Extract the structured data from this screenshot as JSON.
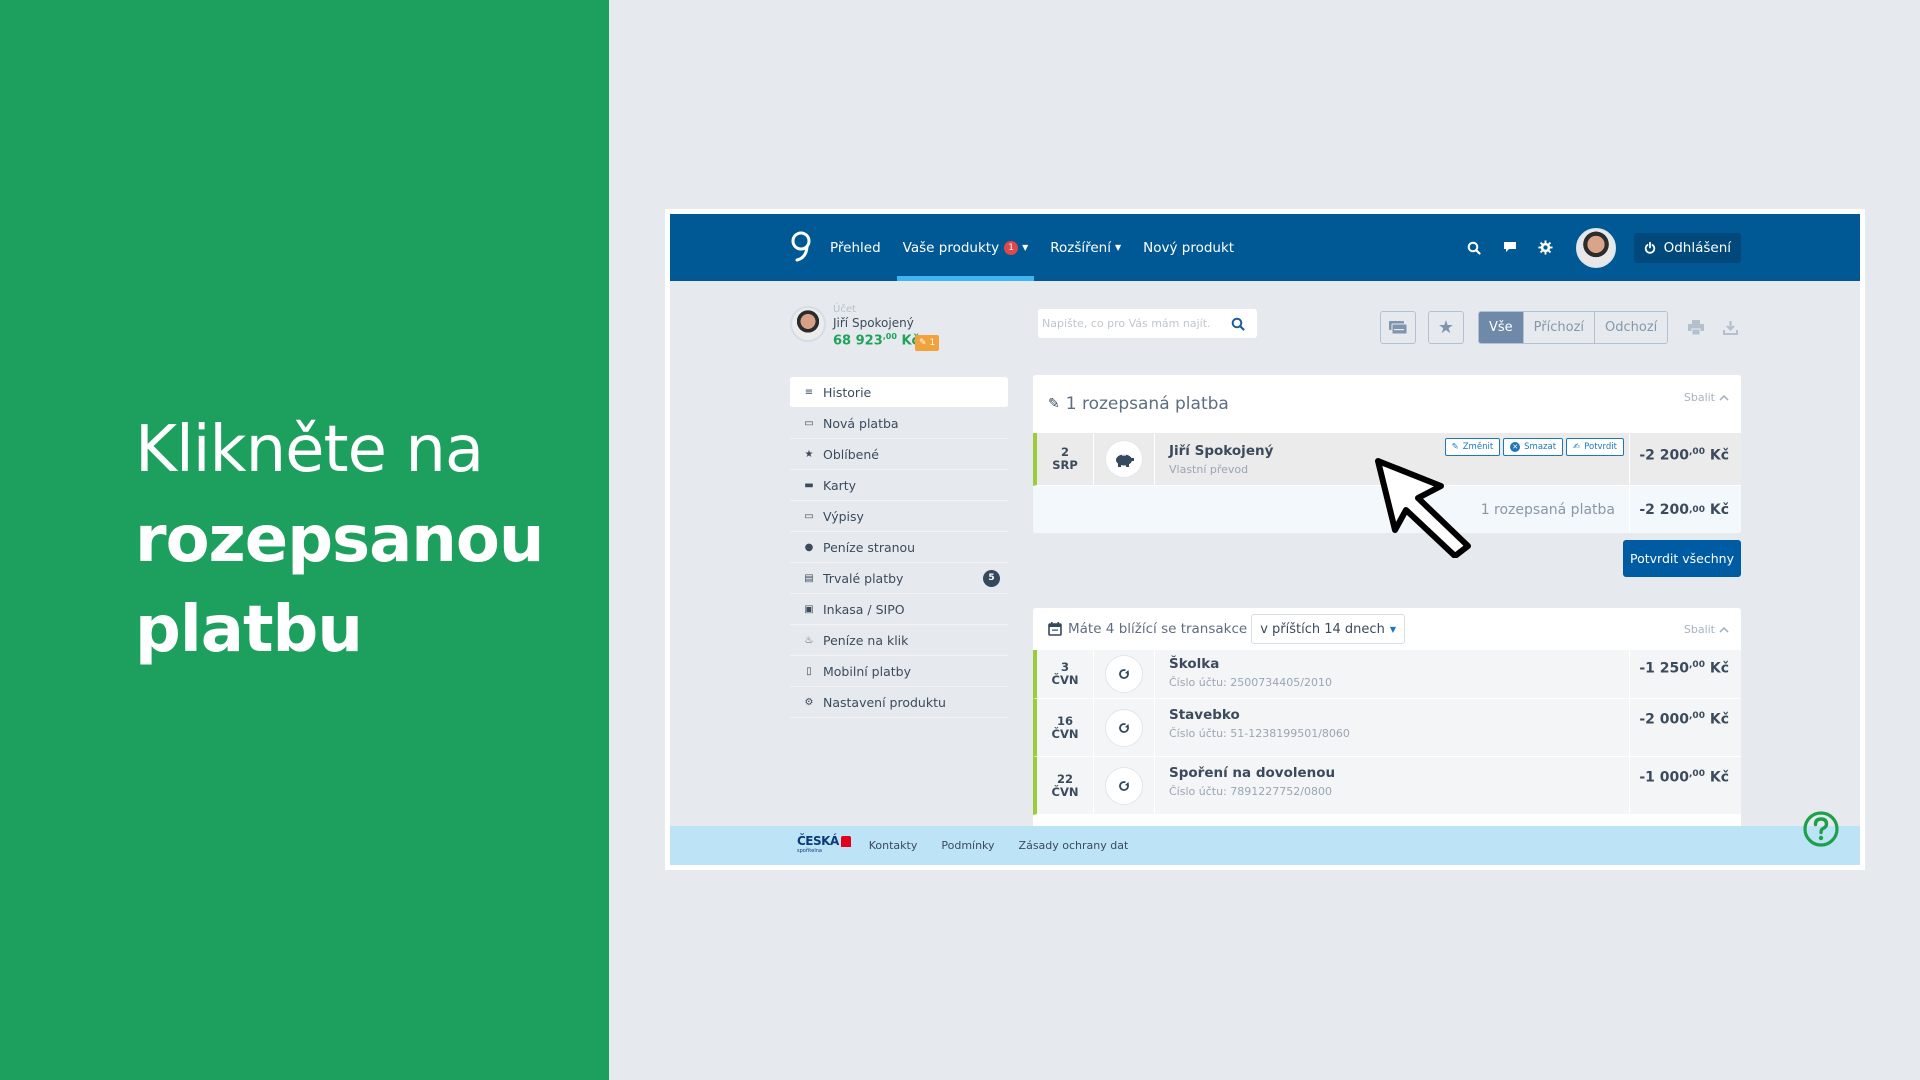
{
  "instruction": {
    "line1": "Klikněte na",
    "line2": "rozepsanou",
    "line3": "platbu"
  },
  "header": {
    "logo_icon": "george-logo-icon",
    "nav": [
      {
        "label": "Přehled",
        "active": false
      },
      {
        "label": "Vaše produkty",
        "active": true,
        "badge": "1",
        "dropdown": true
      },
      {
        "label": "Rozšíření",
        "active": false,
        "dropdown": true
      },
      {
        "label": "Nový produkt",
        "active": false
      }
    ],
    "icons": [
      "search-icon",
      "chat-icon",
      "gear-icon"
    ],
    "logout_label": "Odhlášení"
  },
  "profile": {
    "label": "Účet",
    "name": "Jiří Spokojený",
    "balance_main": "68 923",
    "balance_decimals": ",00",
    "currency": "Kč",
    "pending_count": "1"
  },
  "sidebar": {
    "items": [
      {
        "label": "Historie",
        "icon": "list-icon",
        "glyph": "≡",
        "active": true
      },
      {
        "label": "Nová platba",
        "icon": "payment-icon",
        "glyph": "▭"
      },
      {
        "label": "Oblíbené",
        "icon": "star-icon",
        "glyph": "★"
      },
      {
        "label": "Karty",
        "icon": "card-icon",
        "glyph": "▬"
      },
      {
        "label": "Výpisy",
        "icon": "statement-icon",
        "glyph": "▭"
      },
      {
        "label": "Peníze stranou",
        "icon": "piggy-bank-icon",
        "glyph": "●"
      },
      {
        "label": "Trvalé platby",
        "icon": "clipboard-icon",
        "glyph": "▤",
        "count": "5"
      },
      {
        "label": "Inkasa / SIPO",
        "icon": "clipboard-check-icon",
        "glyph": "▣"
      },
      {
        "label": "Peníze na klik",
        "icon": "click-money-icon",
        "glyph": "♨"
      },
      {
        "label": "Mobilní platby",
        "icon": "mobile-icon",
        "glyph": "▯"
      },
      {
        "label": "Nastavení produktu",
        "icon": "cogs-icon",
        "glyph": "⚙"
      }
    ]
  },
  "search": {
    "placeholder": "Napište, co pro Vás mám najít."
  },
  "toolbar": {
    "filters": [
      {
        "label": "Vše",
        "active": true
      },
      {
        "label": "Příchozí",
        "active": false
      },
      {
        "label": "Odchozí",
        "active": false
      }
    ]
  },
  "drafts": {
    "title": "1 rozepsaná platba",
    "collapse_label": "Sbalit",
    "rows": [
      {
        "day": "2",
        "month": "SRP",
        "name": "Jiří Spokojený",
        "sub": "Vlastní převod",
        "amount": "-2 200",
        "decimals": ",00",
        "currency": "Kč"
      }
    ],
    "actions": {
      "edit": "Změnit",
      "delete": "Smazat",
      "confirm": "Potvrdit"
    },
    "summary_label": "1 rozepsaná platba",
    "summary_amount": "-2 200",
    "summary_decimals": ",00",
    "summary_currency": "Kč",
    "confirm_all_label": "Potvrdit všechny"
  },
  "upcoming": {
    "title": "Máte 4 blížící se transakce",
    "period": "v příštích 14 dnech",
    "collapse_label": "Sbalit",
    "rows": [
      {
        "day": "3",
        "month": "ČVN",
        "name": "Školka",
        "sub": "Číslo účtu: 2500734405/2010",
        "amount": "-1 250",
        "decimals": ",00",
        "currency": "Kč"
      },
      {
        "day": "16",
        "month": "ČVN",
        "name": "Stavebko",
        "sub": "Číslo účtu: 51-1238199501/8060",
        "amount": "-2 000",
        "decimals": ",00",
        "currency": "Kč"
      },
      {
        "day": "22",
        "month": "ČVN",
        "name": "Spoření na dovolenou",
        "sub": "Číslo účtu: 7891227752/0800",
        "amount": "-1 000",
        "decimals": ",00",
        "currency": "Kč"
      }
    ]
  },
  "footer": {
    "brand_top": "ČESKÁ",
    "brand_bottom": "spořitelna",
    "links": [
      "Kontakty",
      "Podmínky",
      "Zásady ochrany dat"
    ]
  },
  "colors": {
    "green_panel": "#1da05e",
    "header_blue": "#005994",
    "active_tab": "#3fb5f5",
    "balance_green": "#1fa35a",
    "pending_orange": "#f2a23b",
    "row_accent": "#9ccc3c",
    "confirm_blue": "#005ca2",
    "footer_bg": "#bde3f7",
    "help_green": "#1da04a"
  }
}
